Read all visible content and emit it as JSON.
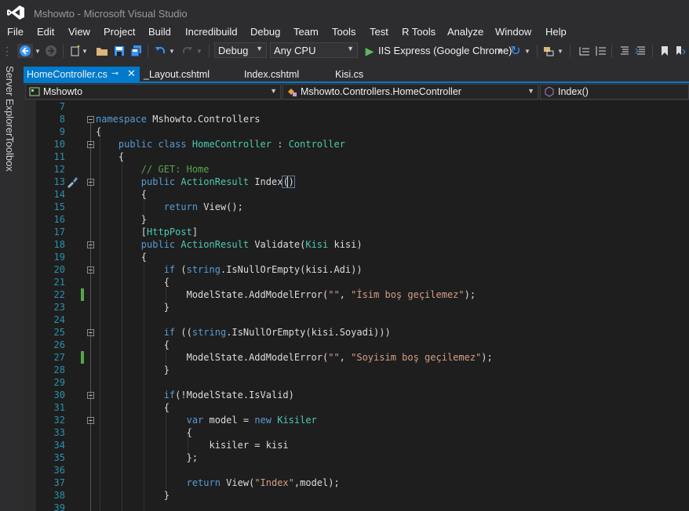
{
  "window": {
    "title": "Mshowto - Microsoft Visual Studio"
  },
  "menu": [
    "File",
    "Edit",
    "View",
    "Project",
    "Build",
    "Incredibuild",
    "Debug",
    "Team",
    "Tools",
    "Test",
    "R Tools",
    "Analyze",
    "Window",
    "Help"
  ],
  "toolbar": {
    "config": "Debug",
    "platform": "Any CPU",
    "run_target": "IIS Express (Google Chrome)"
  },
  "side_panels": [
    "Server Explorer",
    "Toolbox"
  ],
  "tabs": [
    {
      "label": "HomeController.cs",
      "active": true,
      "pinned": true
    },
    {
      "label": "_Layout.cshtml",
      "active": false
    },
    {
      "label": "Index.cshtml",
      "active": false
    },
    {
      "label": "Kisi.cs",
      "active": false
    }
  ],
  "navbar": {
    "project": "Mshowto",
    "type": "Mshowto.Controllers.HomeController",
    "member": "Index()"
  },
  "colors": {
    "accent": "#007acc",
    "keyword": "#569cd6",
    "type": "#4ec9b0",
    "string": "#d69d85",
    "comment": "#57a64a",
    "line_number": "#2b91af"
  },
  "code": {
    "line_numbers": [
      "7",
      "8",
      "9",
      "10",
      "11",
      "12",
      "13",
      "14",
      "15",
      "16",
      "17",
      "18",
      "19",
      "20",
      "21",
      "22",
      "23",
      "24",
      "25",
      "26",
      "27",
      "28",
      "29",
      "30",
      "31",
      "32",
      "33",
      "34",
      "35",
      "36",
      "37",
      "38",
      "39"
    ],
    "tokens": {
      "l8a": "namespace",
      "l8b": " Mshowto.Controllers",
      "l9": "{",
      "l10a": "public class",
      "l10b": " ",
      "l10c": "HomeController",
      "l10d": " : ",
      "l10e": "Controller",
      "l11": "{",
      "l12": "// GET: Home",
      "l13a": "public",
      "l13b": " ",
      "l13c": "ActionResult",
      "l13d": " Index",
      "l13e": "()",
      "l14": "{",
      "l15a": "return",
      "l15b": " View();",
      "l16": "}",
      "l17a": "[",
      "l17b": "HttpPost",
      "l17c": "]",
      "l18a": "public",
      "l18b": " ",
      "l18c": "ActionResult",
      "l18d": " Validate(",
      "l18e": "Kisi",
      "l18f": " kisi)",
      "l19": "{",
      "l20a": "if",
      "l20b": " (",
      "l20c": "string",
      "l20d": ".IsNullOrEmpty(kisi.Adi))",
      "l21": "{",
      "l22a": "ModelState.AddModelError(",
      "l22b": "\"\"",
      "l22c": ", ",
      "l22d": "\"İsim boş geçilemez\"",
      "l22e": ");",
      "l23": "}",
      "l25a": "if",
      "l25b": " ((",
      "l25c": "string",
      "l25d": ".IsNullOrEmpty(kisi.Soyadi)))",
      "l26": "{",
      "l27a": "ModelState.AddModelError(",
      "l27b": "\"\"",
      "l27c": ", ",
      "l27d": "\"Soyisim boş geçilemez\"",
      "l27e": ");",
      "l28": "}",
      "l30a": "if",
      "l30b": "(!ModelState.IsValid)",
      "l31": "{",
      "l32a": "var",
      "l32b": " model = ",
      "l32c": "new",
      "l32d": " ",
      "l32e": "Kisiler",
      "l33": "{",
      "l34": "kisiler = kisi",
      "l35": "};",
      "l37a": "return",
      "l37b": " View(",
      "l37c": "\"Index\"",
      "l37d": ",model);",
      "l38": "}"
    }
  }
}
